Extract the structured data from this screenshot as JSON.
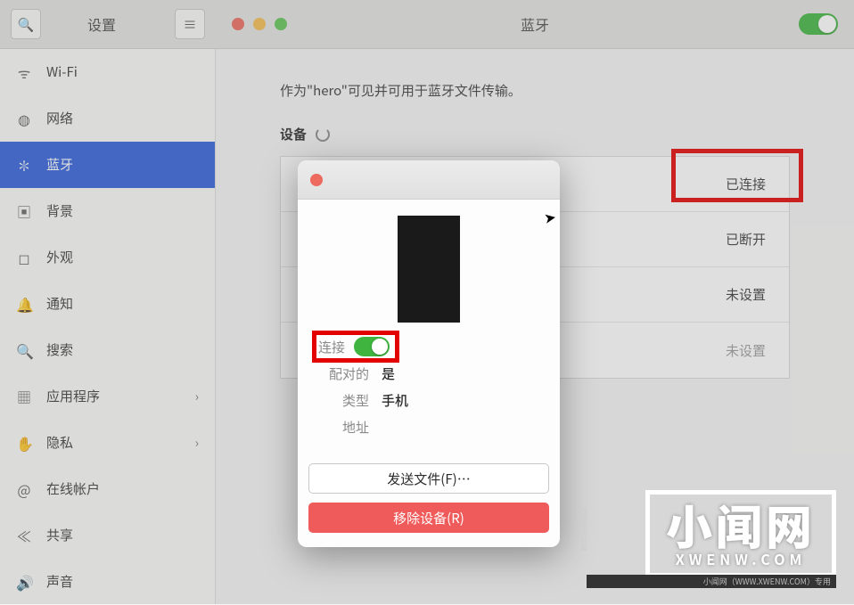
{
  "header": {
    "settings_title": "设置",
    "panel_title": "蓝牙"
  },
  "sidebar": {
    "items": [
      {
        "icon": "wifi",
        "label": "Wi-Fi"
      },
      {
        "icon": "globe",
        "label": "网络"
      },
      {
        "icon": "bt",
        "label": "蓝牙",
        "active": true
      },
      {
        "icon": "image",
        "label": "背景"
      },
      {
        "icon": "appearance",
        "label": "外观"
      },
      {
        "icon": "bell",
        "label": "通知"
      },
      {
        "icon": "search",
        "label": "搜索"
      },
      {
        "icon": "apps",
        "label": "应用程序",
        "chevron": true
      },
      {
        "icon": "hand",
        "label": "隐私",
        "chevron": true
      },
      {
        "icon": "at",
        "label": "在线帐户"
      },
      {
        "icon": "share",
        "label": "共享"
      },
      {
        "icon": "sound",
        "label": "声音"
      }
    ]
  },
  "content": {
    "visibility_text": "作为\"hero\"可见并可用于蓝牙文件传输。",
    "devices_label": "设备",
    "device_rows": [
      {
        "status": "已连接"
      },
      {
        "status": "已断开"
      },
      {
        "status": "未设置"
      },
      {
        "status": "未设置"
      }
    ]
  },
  "dialog": {
    "props": {
      "connect_label": "连接",
      "paired_label": "配对的",
      "paired_value": "是",
      "type_label": "类型",
      "type_value": "手机",
      "address_label": "地址",
      "address_value": ""
    },
    "actions": {
      "send_file": "发送文件(F)…",
      "remove_device": "移除设备(R)"
    }
  },
  "watermark": {
    "big": "小闻网",
    "small": "XWENW.COM",
    "strip": "小闻网（WWW.XWENW.COM）专用",
    "side": "XWENW.COM"
  }
}
